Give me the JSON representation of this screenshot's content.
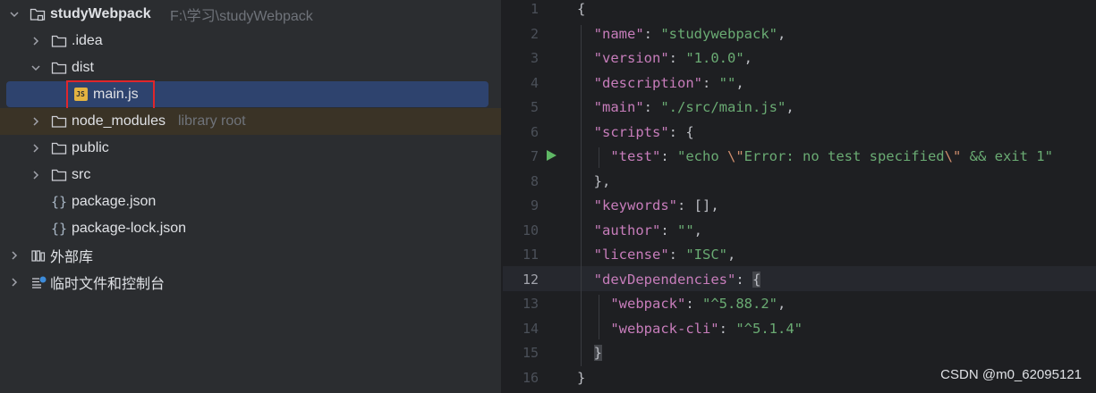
{
  "project_tree": {
    "root": {
      "name": "studyWebpack",
      "path": "F:\\学习\\studyWebpack"
    },
    "items": [
      {
        "label": ".idea",
        "type": "folder"
      },
      {
        "label": "dist",
        "type": "folder"
      },
      {
        "label": "main.js",
        "type": "js-file",
        "badge": "JS"
      },
      {
        "label": "node_modules",
        "type": "folder",
        "hint": "library root"
      },
      {
        "label": "public",
        "type": "folder"
      },
      {
        "label": "src",
        "type": "folder"
      },
      {
        "label": "package.json",
        "type": "json-file"
      },
      {
        "label": "package-lock.json",
        "type": "json-file"
      },
      {
        "label": "外部库",
        "type": "libraries"
      },
      {
        "label": "临时文件和控制台",
        "type": "scratches"
      }
    ]
  },
  "editor": {
    "current_line": 12,
    "lines": [
      {
        "n": "1"
      },
      {
        "n": "2"
      },
      {
        "n": "3"
      },
      {
        "n": "4"
      },
      {
        "n": "5"
      },
      {
        "n": "6"
      },
      {
        "n": "7"
      },
      {
        "n": "8"
      },
      {
        "n": "9"
      },
      {
        "n": "10"
      },
      {
        "n": "11"
      },
      {
        "n": "12"
      },
      {
        "n": "13"
      },
      {
        "n": "14"
      },
      {
        "n": "15"
      },
      {
        "n": "16"
      }
    ],
    "json": {
      "name_key": "\"name\"",
      "name_val": "\"studywebpack\"",
      "version_key": "\"version\"",
      "version_val": "\"1.0.0\"",
      "description_key": "\"description\"",
      "description_val": "\"\"",
      "main_key": "\"main\"",
      "main_val": "\"./src/main.js\"",
      "scripts_key": "\"scripts\"",
      "test_key": "\"test\"",
      "test_val_a": "\"echo ",
      "test_esc1": "\\\"",
      "test_val_b": "Error: no test specified",
      "test_esc2": "\\\"",
      "test_val_c": " && exit 1\"",
      "keywords_key": "\"keywords\"",
      "author_key": "\"author\"",
      "author_val": "\"\"",
      "license_key": "\"license\"",
      "license_val": "\"ISC\"",
      "devdeps_key": "\"devDependencies\"",
      "webpack_key": "\"webpack\"",
      "webpack_val": "\"^5.88.2\"",
      "webpackcli_key": "\"webpack-cli\"",
      "webpackcli_val": "\"^5.1.4\""
    }
  },
  "watermark": "CSDN @m0_62095121",
  "colors": {
    "selection": "#2e436e",
    "highlight_box": "#e0262b",
    "json_key": "#c77dbb",
    "json_string": "#6aab73",
    "run_icon": "#5fb865"
  }
}
